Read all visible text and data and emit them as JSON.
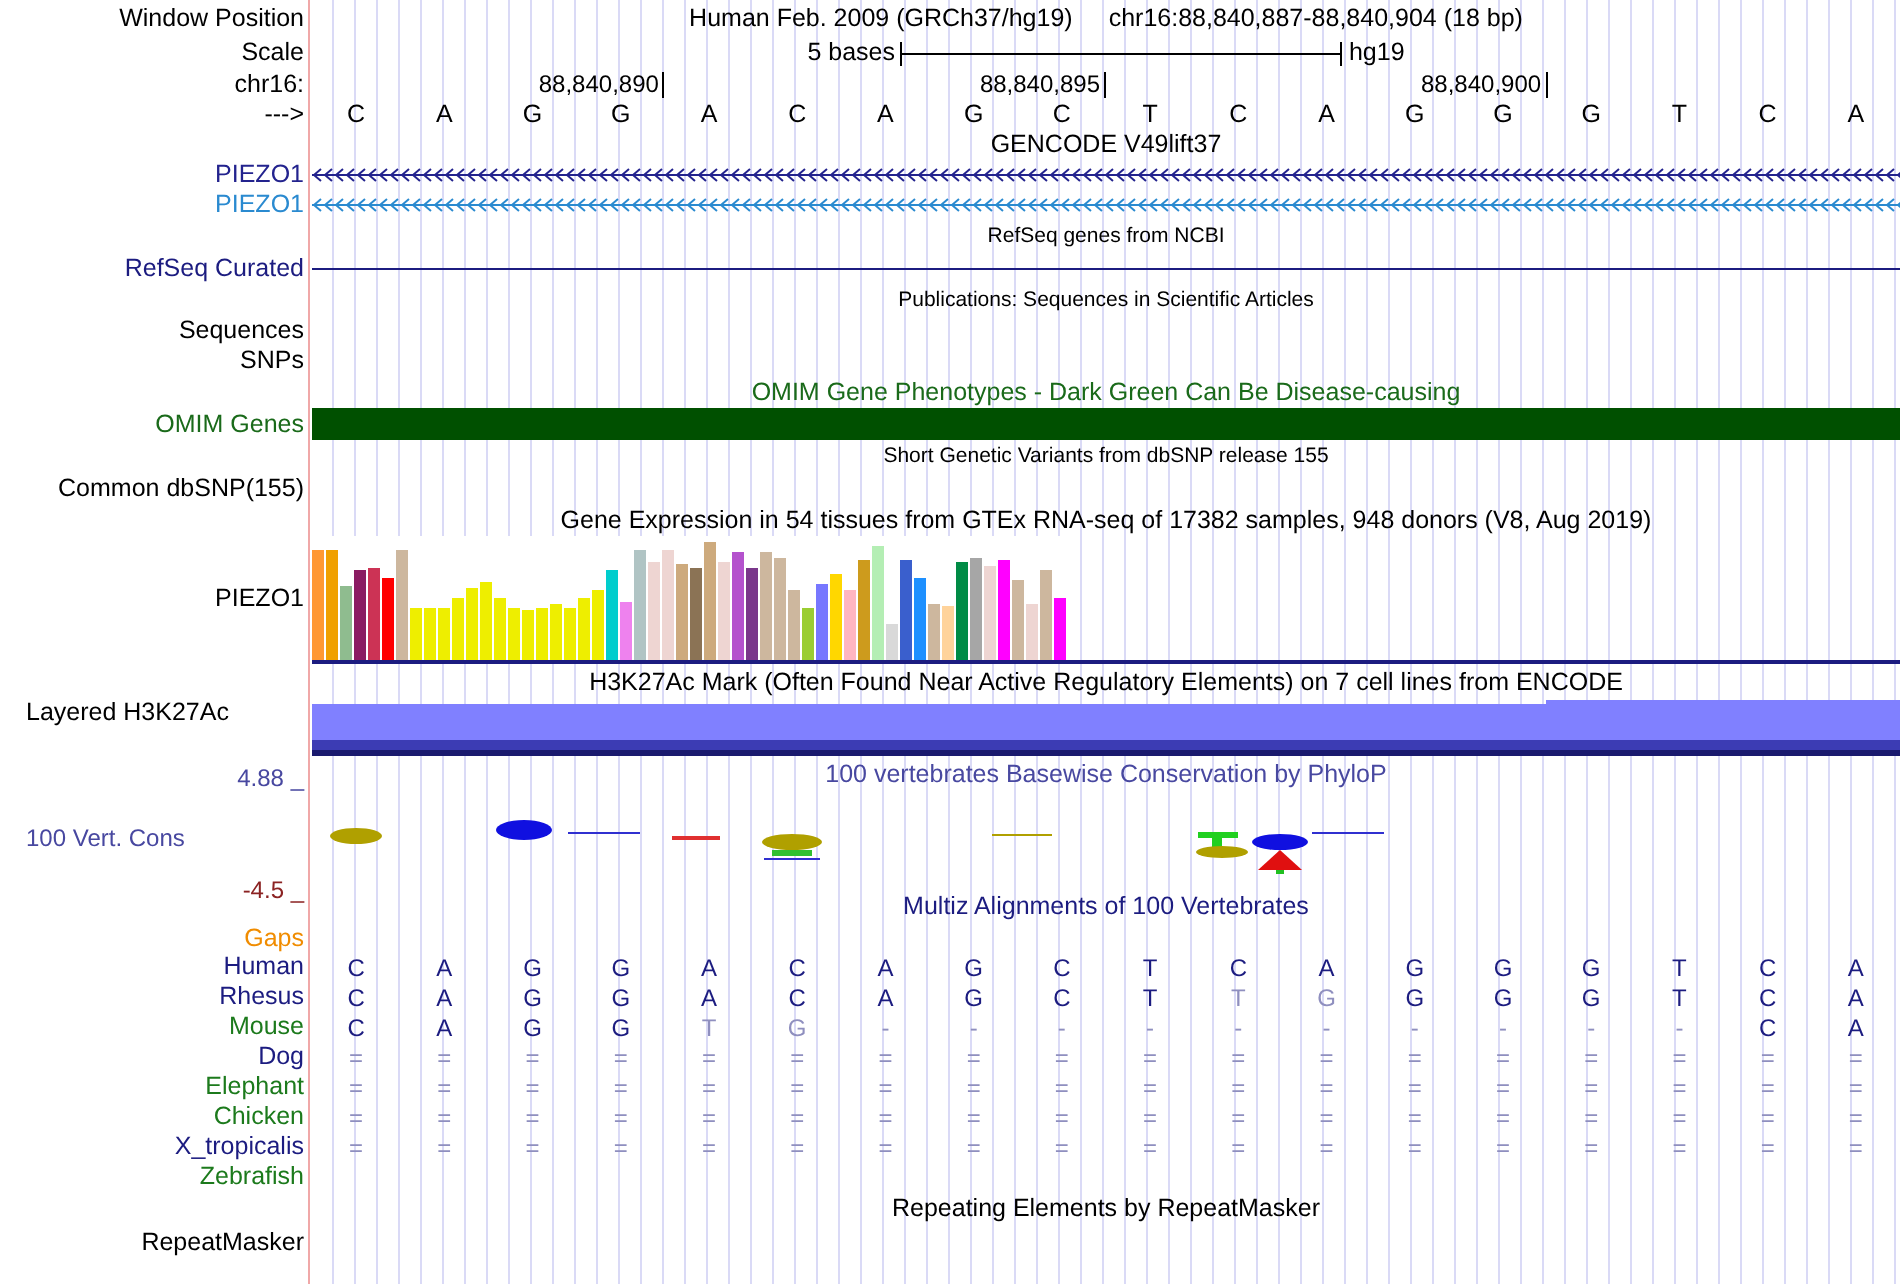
{
  "header": {
    "label": "Window Position",
    "assembly": "Human Feb. 2009 (GRCh37/hg19)",
    "position": "chr16:88,840,887-88,840,904 (18 bp)"
  },
  "scale": {
    "label": "Scale",
    "length": "5 bases",
    "assembly": "hg19"
  },
  "ruler": {
    "label": "chr16:",
    "ticks": [
      "88,840,890",
      "88,840,895",
      "88,840,900"
    ]
  },
  "sequence": {
    "label": "--->",
    "bases": [
      "C",
      "A",
      "G",
      "G",
      "A",
      "C",
      "A",
      "G",
      "C",
      "T",
      "C",
      "A",
      "G",
      "G",
      "G",
      "T",
      "C",
      "A"
    ]
  },
  "gencode": {
    "title": "GENCODE V49lift37",
    "rows": [
      {
        "label": "PIEZO1",
        "color": "#23238e"
      },
      {
        "label": "PIEZO1",
        "color": "#2a8ad0"
      }
    ]
  },
  "refseq": {
    "title": "RefSeq genes from NCBI",
    "label": "RefSeq Curated"
  },
  "publications": {
    "title": "Publications: Sequences in Scientific Articles",
    "labels": [
      "Sequences",
      "SNPs"
    ]
  },
  "omim": {
    "title": "OMIM Gene Phenotypes - Dark Green Can Be Disease-causing",
    "label": "OMIM Genes"
  },
  "dbsnp": {
    "title": "Short Genetic Variants from dbSNP release 155",
    "label": "Common dbSNP(155)"
  },
  "gtex": {
    "title": "Gene Expression in 54 tissues from GTEx RNA-seq of 17382 samples, 948 donors (V8, Aug 2019)",
    "label": "PIEZO1"
  },
  "h3k27ac": {
    "title": "H3K27Ac Mark (Often Found Near Active Regulatory Elements) on 7 cell lines from ENCODE",
    "label": "Layered H3K27Ac"
  },
  "phylop": {
    "title": "100 vertebrates Basewise Conservation by PhyloP",
    "label": "100 Vert. Cons",
    "max": "4.88 _",
    "min": "-4.5 _"
  },
  "alignment": {
    "title": "Multiz Alignments of 100 Vertebrates",
    "gaps_label": "Gaps",
    "species": [
      {
        "name": "Human",
        "color": "#1c1c80",
        "cells": [
          {
            "base": "C",
            "muted": false
          },
          {
            "base": "A",
            "muted": false
          },
          {
            "base": "G",
            "muted": false
          },
          {
            "base": "G",
            "muted": false
          },
          {
            "base": "A",
            "muted": false
          },
          {
            "base": "C",
            "muted": false
          },
          {
            "base": "A",
            "muted": false
          },
          {
            "base": "G",
            "muted": false
          },
          {
            "base": "C",
            "muted": false
          },
          {
            "base": "T",
            "muted": false
          },
          {
            "base": "C",
            "muted": false
          },
          {
            "base": "A",
            "muted": false
          },
          {
            "base": "G",
            "muted": false
          },
          {
            "base": "G",
            "muted": false
          },
          {
            "base": "G",
            "muted": false
          },
          {
            "base": "T",
            "muted": false
          },
          {
            "base": "C",
            "muted": false
          },
          {
            "base": "A",
            "muted": false
          }
        ]
      },
      {
        "name": "Rhesus",
        "color": "#1c1c80",
        "cells": [
          {
            "base": "C",
            "muted": false
          },
          {
            "base": "A",
            "muted": false
          },
          {
            "base": "G",
            "muted": false
          },
          {
            "base": "G",
            "muted": false
          },
          {
            "base": "A",
            "muted": false
          },
          {
            "base": "C",
            "muted": false
          },
          {
            "base": "A",
            "muted": false
          },
          {
            "base": "G",
            "muted": false
          },
          {
            "base": "C",
            "muted": false
          },
          {
            "base": "T",
            "muted": false
          },
          {
            "base": "T",
            "muted": true
          },
          {
            "base": "G",
            "muted": true
          },
          {
            "base": "G",
            "muted": false
          },
          {
            "base": "G",
            "muted": false
          },
          {
            "base": "G",
            "muted": false
          },
          {
            "base": "T",
            "muted": false
          },
          {
            "base": "C",
            "muted": false
          },
          {
            "base": "A",
            "muted": false
          }
        ]
      },
      {
        "name": "Mouse",
        "color": "#1c7a1c",
        "cells": [
          {
            "base": "C",
            "muted": false
          },
          {
            "base": "A",
            "muted": false
          },
          {
            "base": "G",
            "muted": false
          },
          {
            "base": "G",
            "muted": false
          },
          {
            "base": "T",
            "muted": true
          },
          {
            "base": "G",
            "muted": true
          },
          {
            "base": "-",
            "muted": true
          },
          {
            "base": "-",
            "muted": true
          },
          {
            "base": "-",
            "muted": true
          },
          {
            "base": "-",
            "muted": true
          },
          {
            "base": "-",
            "muted": true
          },
          {
            "base": "-",
            "muted": true
          },
          {
            "base": "-",
            "muted": true
          },
          {
            "base": "-",
            "muted": true
          },
          {
            "base": "-",
            "muted": true
          },
          {
            "base": "-",
            "muted": true
          },
          {
            "base": "C",
            "muted": false
          },
          {
            "base": "A",
            "muted": false
          }
        ]
      },
      {
        "name": "Dog",
        "color": "#1c1c80",
        "cells": [
          {
            "base": "=",
            "muted": true
          },
          {
            "base": "=",
            "muted": true
          },
          {
            "base": "=",
            "muted": true
          },
          {
            "base": "=",
            "muted": true
          },
          {
            "base": "=",
            "muted": true
          },
          {
            "base": "=",
            "muted": true
          },
          {
            "base": "=",
            "muted": true
          },
          {
            "base": "=",
            "muted": true
          },
          {
            "base": "=",
            "muted": true
          },
          {
            "base": "=",
            "muted": true
          },
          {
            "base": "=",
            "muted": true
          },
          {
            "base": "=",
            "muted": true
          },
          {
            "base": "=",
            "muted": true
          },
          {
            "base": "=",
            "muted": true
          },
          {
            "base": "=",
            "muted": true
          },
          {
            "base": "=",
            "muted": true
          },
          {
            "base": "=",
            "muted": true
          },
          {
            "base": "=",
            "muted": true
          }
        ]
      },
      {
        "name": "Elephant",
        "color": "#1c7a1c",
        "cells": [
          {
            "base": "=",
            "muted": true
          },
          {
            "base": "=",
            "muted": true
          },
          {
            "base": "=",
            "muted": true
          },
          {
            "base": "=",
            "muted": true
          },
          {
            "base": "=",
            "muted": true
          },
          {
            "base": "=",
            "muted": true
          },
          {
            "base": "=",
            "muted": true
          },
          {
            "base": "=",
            "muted": true
          },
          {
            "base": "=",
            "muted": true
          },
          {
            "base": "=",
            "muted": true
          },
          {
            "base": "=",
            "muted": true
          },
          {
            "base": "=",
            "muted": true
          },
          {
            "base": "=",
            "muted": true
          },
          {
            "base": "=",
            "muted": true
          },
          {
            "base": "=",
            "muted": true
          },
          {
            "base": "=",
            "muted": true
          },
          {
            "base": "=",
            "muted": true
          },
          {
            "base": "=",
            "muted": true
          }
        ]
      },
      {
        "name": "Chicken",
        "color": "#1c7a1c",
        "cells": [
          {
            "base": "=",
            "muted": true
          },
          {
            "base": "=",
            "muted": true
          },
          {
            "base": "=",
            "muted": true
          },
          {
            "base": "=",
            "muted": true
          },
          {
            "base": "=",
            "muted": true
          },
          {
            "base": "=",
            "muted": true
          },
          {
            "base": "=",
            "muted": true
          },
          {
            "base": "=",
            "muted": true
          },
          {
            "base": "=",
            "muted": true
          },
          {
            "base": "=",
            "muted": true
          },
          {
            "base": "=",
            "muted": true
          },
          {
            "base": "=",
            "muted": true
          },
          {
            "base": "=",
            "muted": true
          },
          {
            "base": "=",
            "muted": true
          },
          {
            "base": "=",
            "muted": true
          },
          {
            "base": "=",
            "muted": true
          },
          {
            "base": "=",
            "muted": true
          },
          {
            "base": "=",
            "muted": true
          }
        ]
      },
      {
        "name": "X_tropicalis",
        "color": "#1c1c80",
        "cells": [
          {
            "base": "=",
            "muted": true
          },
          {
            "base": "=",
            "muted": true
          },
          {
            "base": "=",
            "muted": true
          },
          {
            "base": "=",
            "muted": true
          },
          {
            "base": "=",
            "muted": true
          },
          {
            "base": "=",
            "muted": true
          },
          {
            "base": "=",
            "muted": true
          },
          {
            "base": "=",
            "muted": true
          },
          {
            "base": "=",
            "muted": true
          },
          {
            "base": "=",
            "muted": true
          },
          {
            "base": "=",
            "muted": true
          },
          {
            "base": "=",
            "muted": true
          },
          {
            "base": "=",
            "muted": true
          },
          {
            "base": "=",
            "muted": true
          },
          {
            "base": "=",
            "muted": true
          },
          {
            "base": "=",
            "muted": true
          },
          {
            "base": "=",
            "muted": true
          },
          {
            "base": "=",
            "muted": true
          }
        ]
      },
      {
        "name": "Zebrafish",
        "color": "#1c7a1c"
      }
    ]
  },
  "repeatmasker": {
    "title": "Repeating Elements by RepeatMasker",
    "label": "RepeatMasker"
  }
}
